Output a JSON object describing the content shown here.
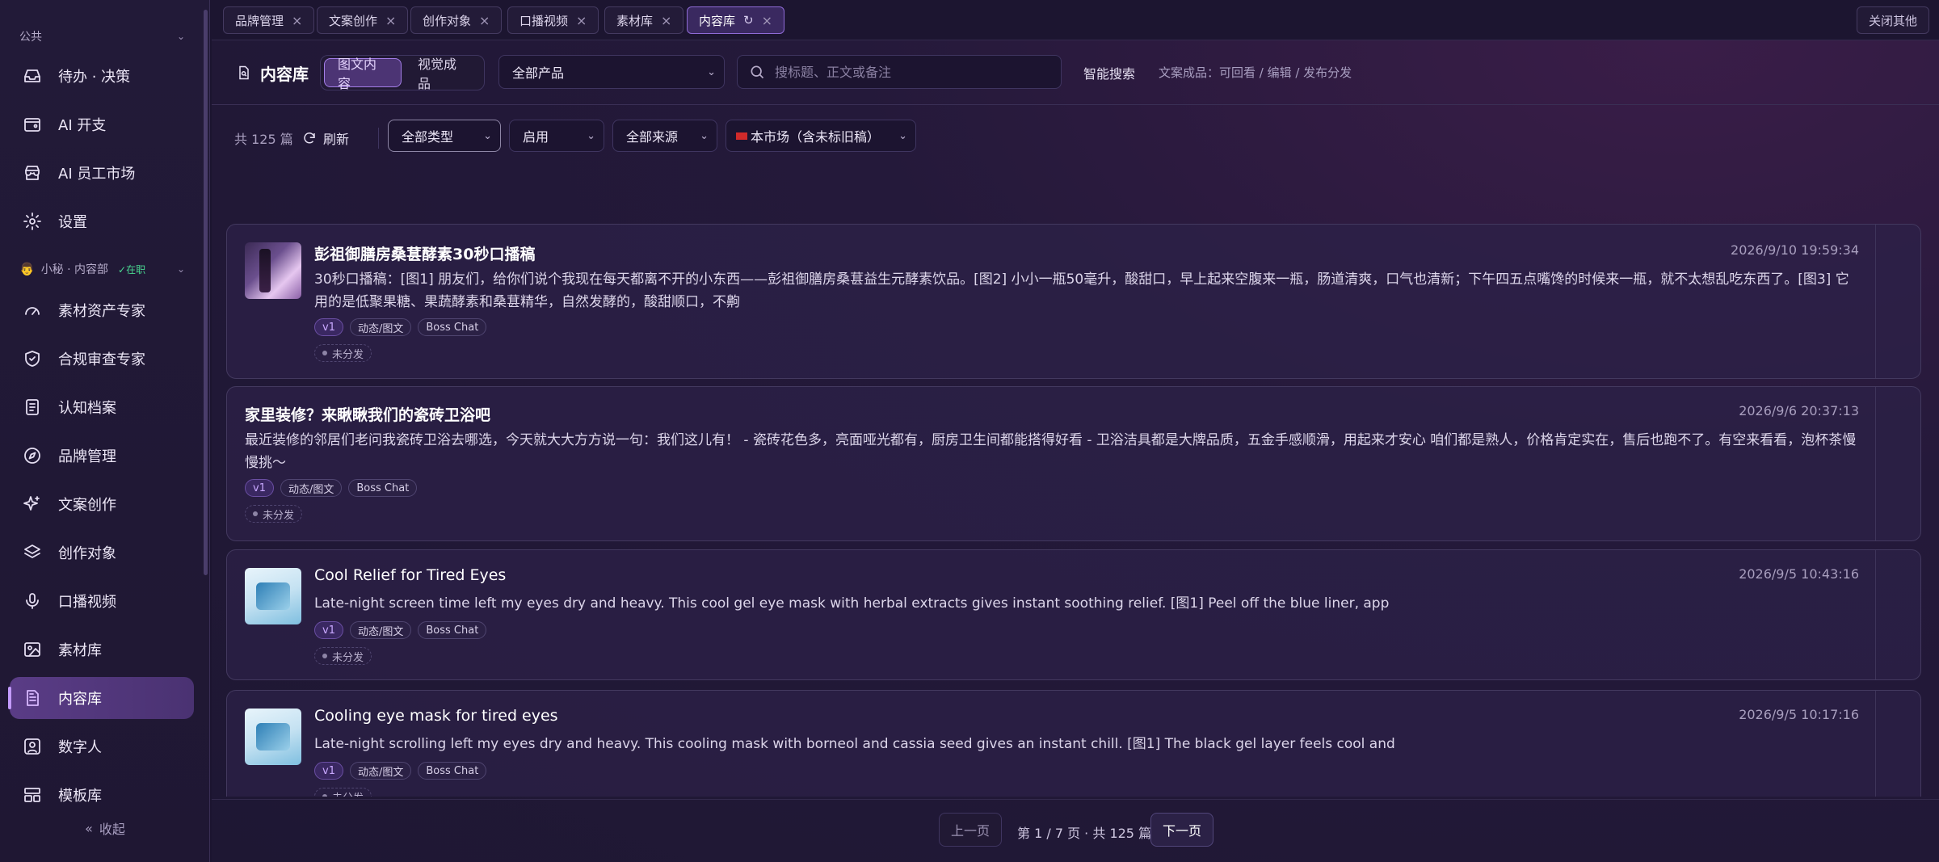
{
  "sidebar": {
    "group_public": "公共",
    "items_public": [
      {
        "label": "待办 · 决策",
        "icon": "inbox-icon"
      },
      {
        "label": "AI 开支",
        "icon": "wallet-icon"
      },
      {
        "label": "AI 员工市场",
        "icon": "store-icon"
      },
      {
        "label": "设置",
        "icon": "gear-icon"
      }
    ],
    "group_dept": "小秘 · 内容部",
    "group_dept_status": "✓在职",
    "items_dept": [
      {
        "label": "素材资产专家",
        "icon": "gauge-icon"
      },
      {
        "label": "合规审查专家",
        "icon": "shield-icon"
      },
      {
        "label": "认知档案",
        "icon": "notebook-icon"
      },
      {
        "label": "品牌管理",
        "icon": "compass-icon"
      },
      {
        "label": "文案创作",
        "icon": "sparkle-icon"
      },
      {
        "label": "创作对象",
        "icon": "layers-icon"
      },
      {
        "label": "口播视频",
        "icon": "mic-icon"
      },
      {
        "label": "素材库",
        "icon": "image-icon"
      },
      {
        "label": "内容库",
        "icon": "document-icon"
      },
      {
        "label": "数字人",
        "icon": "user-square-icon"
      },
      {
        "label": "模板库",
        "icon": "layout-icon"
      }
    ],
    "active_item": "内容库",
    "collapse_label": "收起"
  },
  "tabs": [
    {
      "label": "品牌管理"
    },
    {
      "label": "文案创作"
    },
    {
      "label": "创作对象"
    },
    {
      "label": "口播视频"
    },
    {
      "label": "素材库"
    },
    {
      "label": "内容库",
      "active": true
    }
  ],
  "close_others_label": "关闭其他",
  "header": {
    "title": "内容库",
    "seg_options": [
      "图文内容",
      "视觉成品"
    ],
    "product_select": "全部产品",
    "search_placeholder": "搜标题、正文或备注",
    "smart_search": "智能搜索",
    "hint": "文案成品：可回看 / 编辑 / 发布分发"
  },
  "filters": {
    "count": "共 125 篇",
    "refresh": "刷新",
    "type": "全部类型",
    "status": "启用",
    "source": "全部来源",
    "market": "本市场（含未标旧稿）"
  },
  "cards": [
    {
      "title": "彭祖御膳房桑葚酵素30秒口播稿",
      "time": "2026/9/10 19:59:34",
      "body": "30秒口播稿：[图1] 朋友们，给你们说个我现在每天都离不开的小东西——彭祖御膳房桑葚益生元酵素饮品。[图2] 小小一瓶50毫升，酸甜口，早上起来空腹来一瓶，肠道清爽，口气也清新；下午四五点嘴馋的时候来一瓶，就不太想乱吃东西了。[图3] 它用的是低聚果糖、果蔬酵素和桑葚精华，自然发酵的，酸甜顺口，不齁",
      "tags": [
        "v1",
        "动态/图文",
        "Boss Chat"
      ],
      "dist": "未分发",
      "thumb": "drink"
    },
    {
      "title": "家里装修？来瞅瞅我们的瓷砖卫浴吧",
      "time": "2026/9/6 20:37:13",
      "body": "最近装修的邻居们老问我瓷砖卫浴去哪选，今天就大大方方说一句：我们这儿有！ - 瓷砖花色多，亮面哑光都有，厨房卫生间都能搭得好看 - 卫浴洁具都是大牌品质，五金手感顺滑，用起来才安心 咱们都是熟人，价格肯定实在，售后也跑不了。有空来看看，泡杯茶慢慢挑～",
      "tags": [
        "v1",
        "动态/图文",
        "Boss Chat"
      ],
      "dist": "未分发",
      "thumb": ""
    },
    {
      "title": "Cool Relief for Tired Eyes",
      "time": "2026/9/5 10:43:16",
      "body": "Late-night screen time left my eyes dry and heavy. This cool gel eye mask with herbal extracts gives instant soothing relief. [图1] Peel off the blue liner, app",
      "tags": [
        "v1",
        "动态/图文",
        "Boss Chat"
      ],
      "dist": "未分发",
      "thumb": "mask"
    },
    {
      "title": "Cooling eye mask for tired eyes",
      "time": "2026/9/5 10:17:16",
      "body": "Late-night scrolling left my eyes dry and heavy. This cooling mask with borneol and cassia seed gives an instant chill. [图1] The black gel layer feels cool and",
      "tags": [
        "v1",
        "动态/图文",
        "Boss Chat"
      ],
      "dist": "未分发",
      "thumb": "mask"
    }
  ],
  "pager": {
    "prev": "上一页",
    "info": "第 1 / 7 页 · 共 125 篇",
    "next": "下一页"
  }
}
